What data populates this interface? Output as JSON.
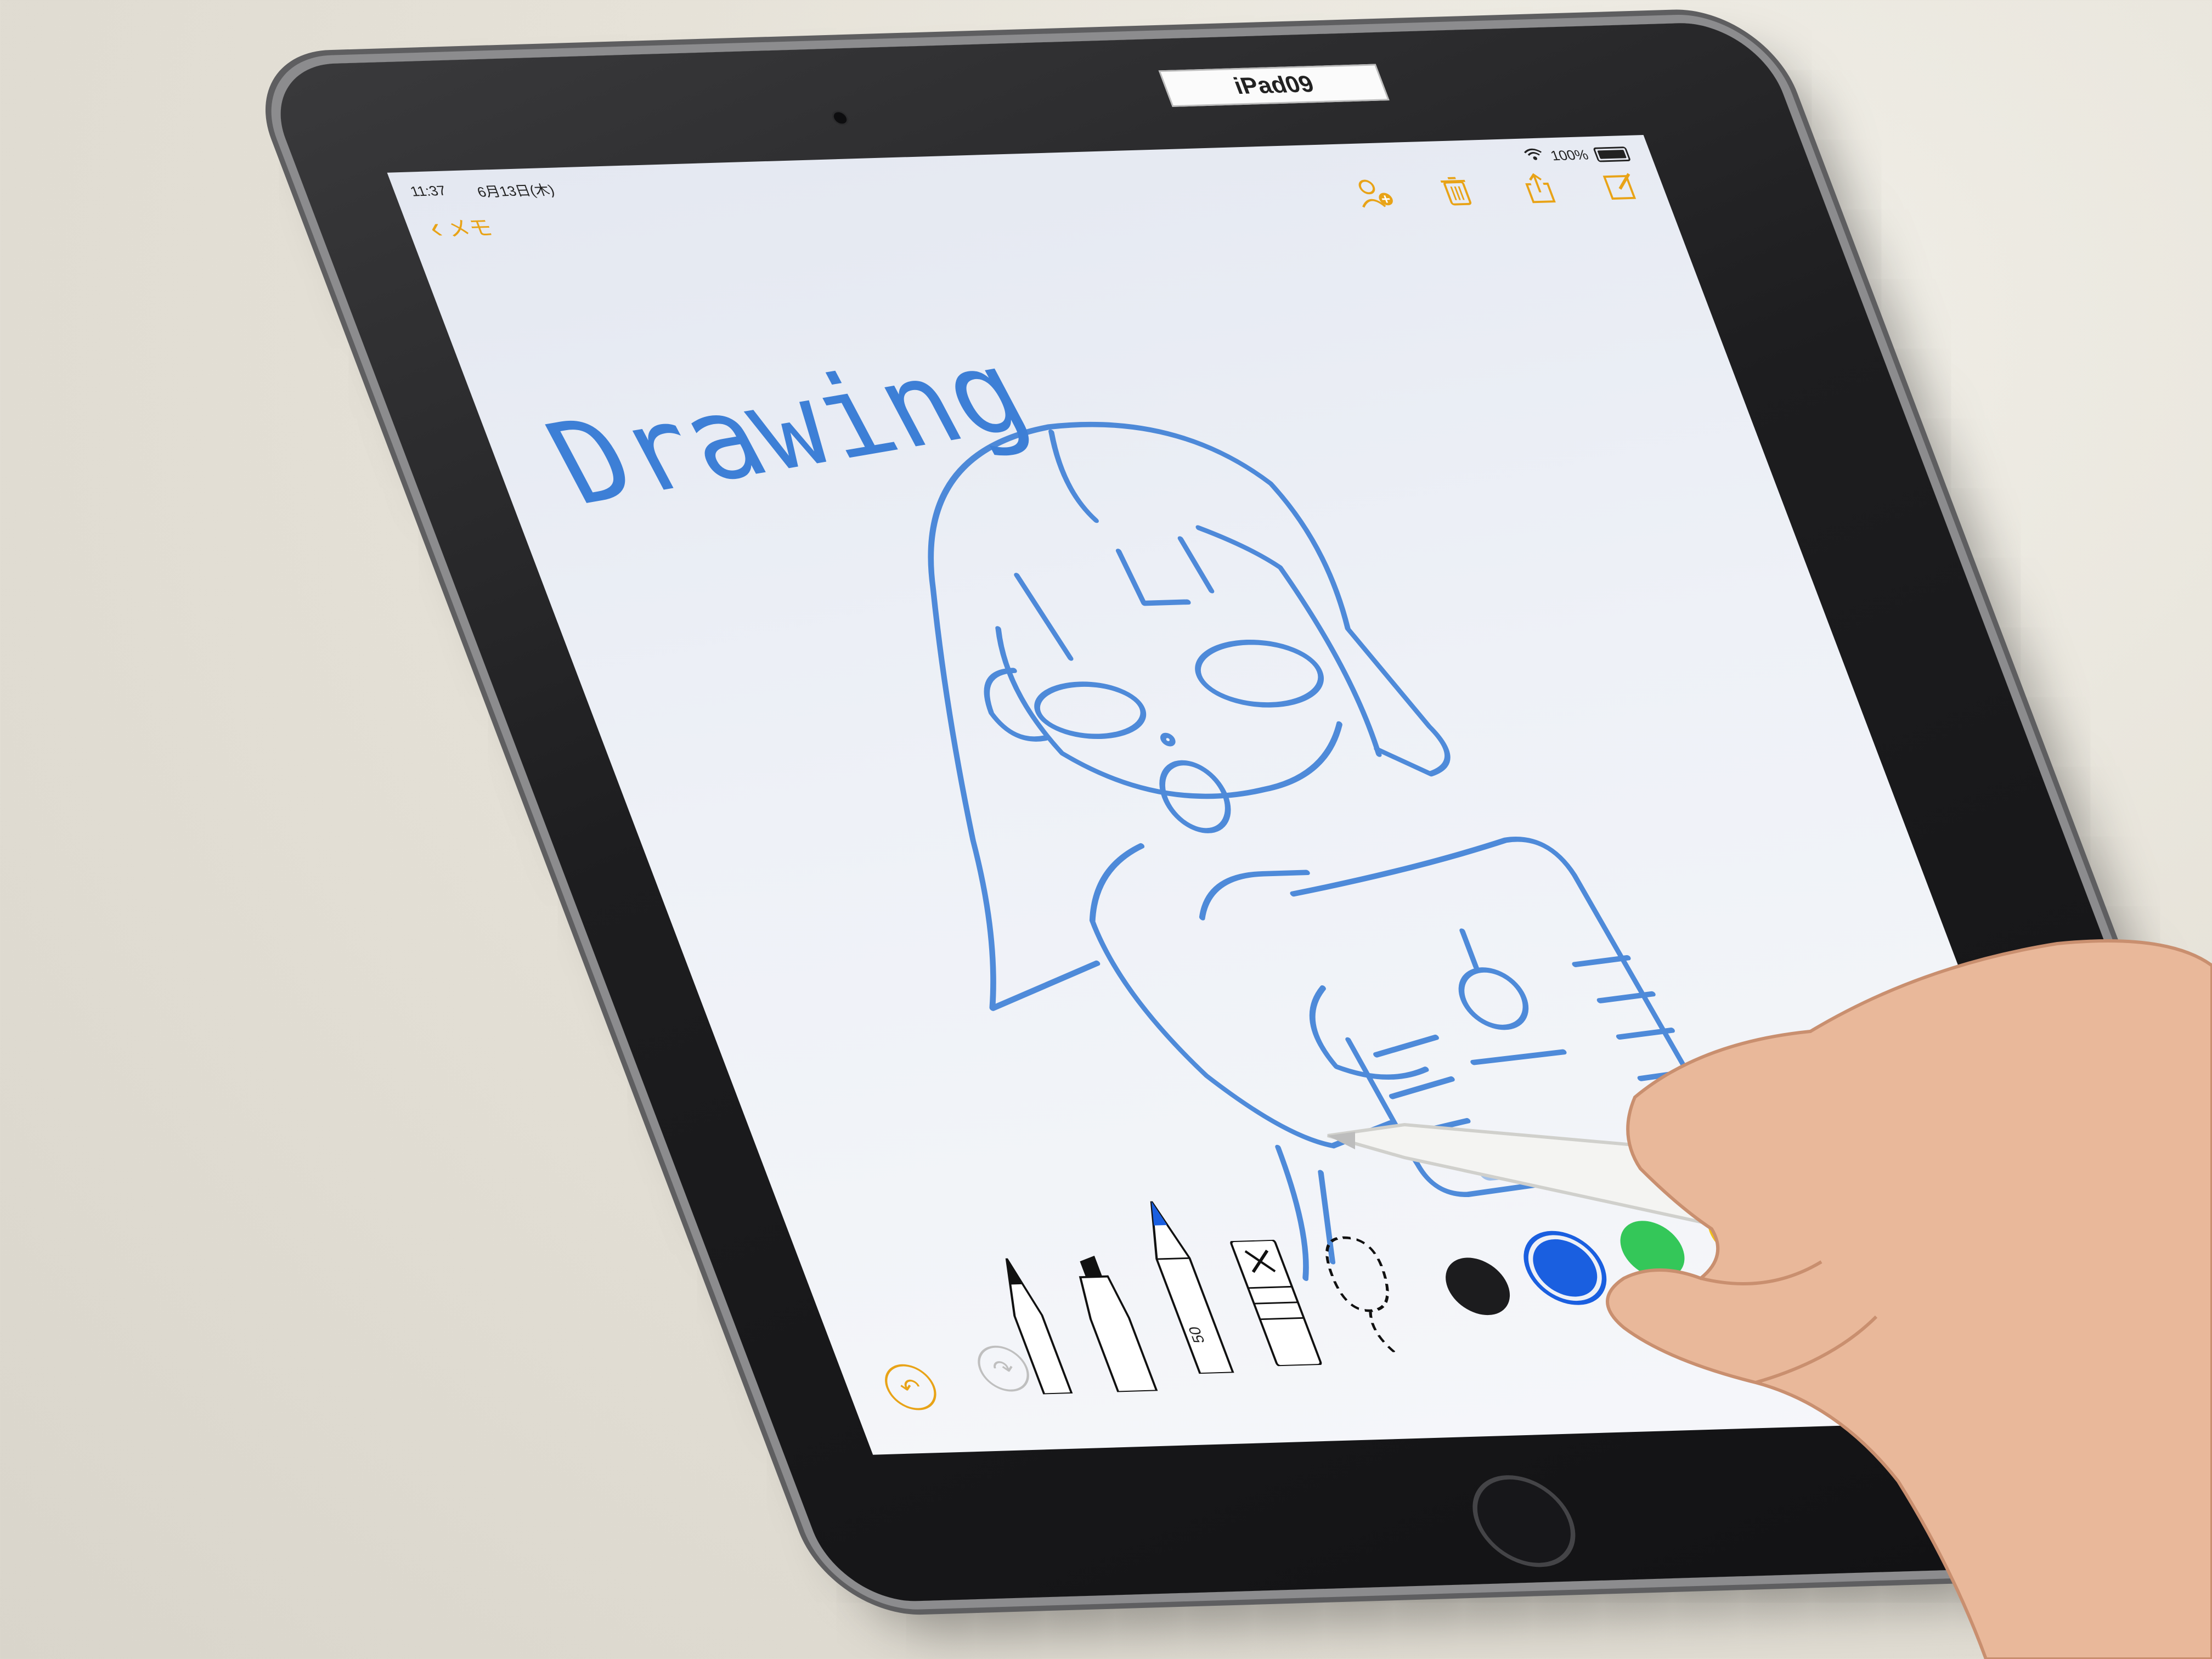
{
  "device": {
    "asset_label": "iPad09"
  },
  "status_bar": {
    "time": "11:37",
    "date": "6月13日(木)",
    "battery": "100%"
  },
  "nav": {
    "back_label": "メモ"
  },
  "note": {
    "handwritten_title": "Drawing"
  },
  "toolbar_top": {
    "icons": [
      "add-people-icon",
      "trash-icon",
      "share-icon",
      "compose-icon"
    ]
  },
  "drawing_tools": {
    "tools": [
      "pen",
      "marker",
      "pencil",
      "eraser",
      "lasso"
    ],
    "selected_tool": "pencil",
    "pencil_width_label": "50",
    "colors": [
      {
        "name": "black",
        "hex": "#1c1c1e",
        "selected": false
      },
      {
        "name": "blue",
        "hex": "#1a5fe0",
        "selected": true
      },
      {
        "name": "green",
        "hex": "#34c759",
        "selected": false
      },
      {
        "name": "yellow",
        "hex": "#f2c21b",
        "selected": false
      },
      {
        "name": "red",
        "hex": "#e8202a",
        "selected": false
      }
    ],
    "color_picker_icon": "color-wheel-icon"
  },
  "accent_color": "#e8a317",
  "ink_color": "#3d7fd6"
}
